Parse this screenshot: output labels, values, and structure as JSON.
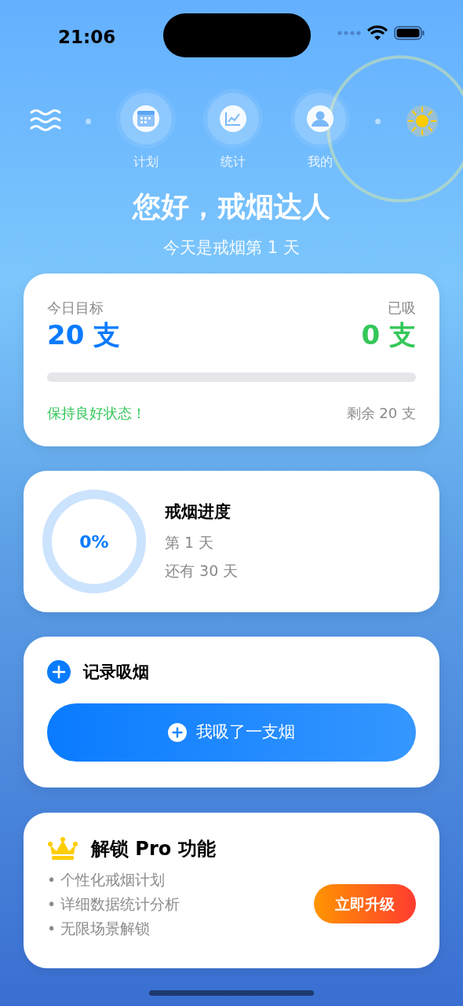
{
  "status_bar": {
    "time": "21:06"
  },
  "nav": [
    {
      "label": "计划",
      "kind": "calendar"
    },
    {
      "label": "统计",
      "kind": "chart"
    },
    {
      "label": "我的",
      "kind": "person"
    }
  ],
  "greeting": {
    "title": "您好，戒烟达人",
    "subtitle": "今天是戒烟第 1 天"
  },
  "today": {
    "goal_label": "今日目标",
    "goal_value": "20 支",
    "smoked_label": "已吸",
    "smoked_value": "0 支",
    "level": 0,
    "message": "保持良好状态！",
    "remaining": "剩余 20 支"
  },
  "progress": {
    "percent": "0%",
    "title": "戒烟进度",
    "day": "第 1 天",
    "left": "还有 30 天"
  },
  "record": {
    "title": "记录吸烟",
    "button": "我吸了一支烟"
  },
  "pro": {
    "title": "解锁 Pro 功能",
    "features": [
      "• 个性化戒烟计划",
      "• 详细数据统计分析",
      "• 无限场景解锁"
    ],
    "button": "立即升级"
  }
}
